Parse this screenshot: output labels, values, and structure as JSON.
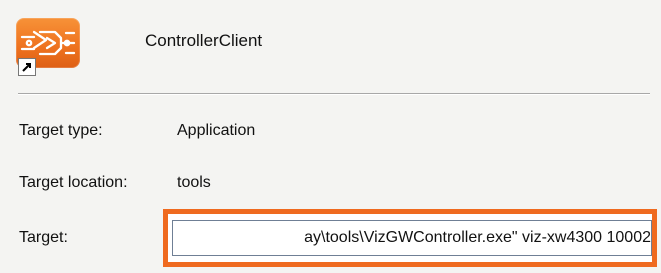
{
  "app": {
    "name": "ControllerClient",
    "icon": "controller-app-icon",
    "shortcut_icon": "shortcut-arrow-icon",
    "accent_color": "#ef6a1f"
  },
  "properties": {
    "target_type": {
      "label": "Target type:",
      "value": "Application"
    },
    "target_location": {
      "label": "Target location:",
      "value": "tools"
    },
    "target": {
      "label": "Target:",
      "value": "ay\\tools\\VizGWController.exe\" viz-xw4300 10002"
    }
  }
}
